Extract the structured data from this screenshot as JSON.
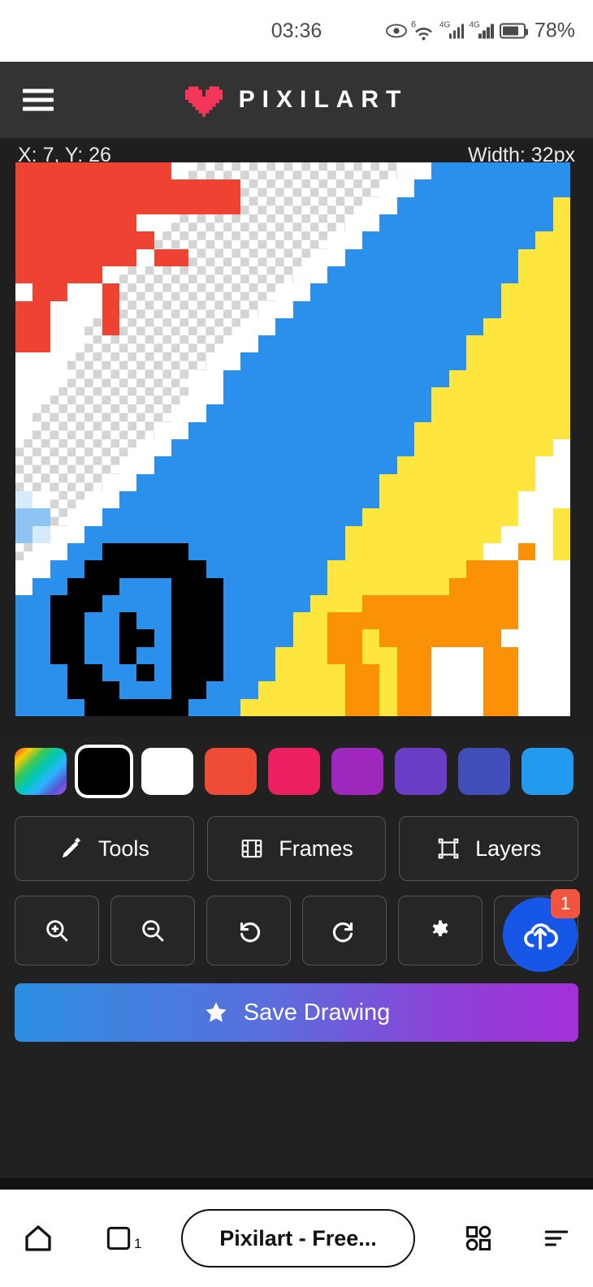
{
  "status_bar": {
    "time": "03:36",
    "battery_percent": "78%",
    "battery_level": 78,
    "wifi_label": "6",
    "network_labels": [
      "4G",
      "4G"
    ],
    "icons": [
      "eye-icon",
      "wifi-icon",
      "signal-icon",
      "signal-icon",
      "battery-icon"
    ]
  },
  "app_header": {
    "menu_icon": "hamburger-menu-icon",
    "logo_icon": "pixel-heart-icon",
    "logo_color": "#f6355a",
    "title": "PIXILART"
  },
  "canvas": {
    "coordinates_label": "X: 7, Y: 26",
    "width_label": "Width: 32px",
    "grid_size": 32,
    "colors": {
      "transparent": "checker",
      "red": "#ee4233",
      "white": "#ffffff",
      "blue": "#2b90ec",
      "light_blue": "#8dc4f3",
      "pale_blue": "#d6ecfc",
      "yellow": "#fee63f",
      "orange": "#fb9106",
      "black": "#000000"
    }
  },
  "palette": {
    "selected_index": 1,
    "swatches": [
      {
        "name": "rainbow-color-picker",
        "color": "rainbow"
      },
      {
        "name": "swatch-black",
        "color": "#000000"
      },
      {
        "name": "swatch-white",
        "color": "#ffffff"
      },
      {
        "name": "swatch-red",
        "color": "#f04b36"
      },
      {
        "name": "swatch-crimson",
        "color": "#ed2061"
      },
      {
        "name": "swatch-magenta",
        "color": "#a027bd"
      },
      {
        "name": "swatch-purple",
        "color": "#6a3ec4"
      },
      {
        "name": "swatch-indigo",
        "color": "#3f4eb8"
      },
      {
        "name": "swatch-blue",
        "color": "#229aef"
      }
    ]
  },
  "tool_buttons": [
    {
      "label": "Tools",
      "icon": "pencil-icon"
    },
    {
      "label": "Frames",
      "icon": "film-strip-icon"
    },
    {
      "label": "Layers",
      "icon": "layers-icon"
    }
  ],
  "icon_buttons": [
    {
      "name": "zoom-in-button",
      "icon": "magnifier-plus-icon"
    },
    {
      "name": "zoom-out-button",
      "icon": "magnifier-minus-icon"
    },
    {
      "name": "undo-button",
      "icon": "undo-arrow-icon"
    },
    {
      "name": "redo-button",
      "icon": "redo-arrow-icon"
    },
    {
      "name": "settings-button",
      "icon": "gear-icon"
    },
    {
      "name": "upload-placeholder",
      "icon": ""
    }
  ],
  "upload_fab": {
    "icon": "cloud-upload-icon",
    "badge_count": "1",
    "color": "#1757e8",
    "badge_color": "#f1543f"
  },
  "save_button": {
    "label": "Save Drawing",
    "icon": "star-icon",
    "gradient_from": "#2b8fe0",
    "gradient_to": "#a42fd8"
  },
  "browser_bar": {
    "home_icon": "home-icon",
    "tabs_icon": "tabs-icon",
    "tab_count": "1",
    "url_label": "Pixilart - Free...",
    "apps_icon": "apps-grid-icon",
    "menu_icon": "menu-lines-icon"
  }
}
